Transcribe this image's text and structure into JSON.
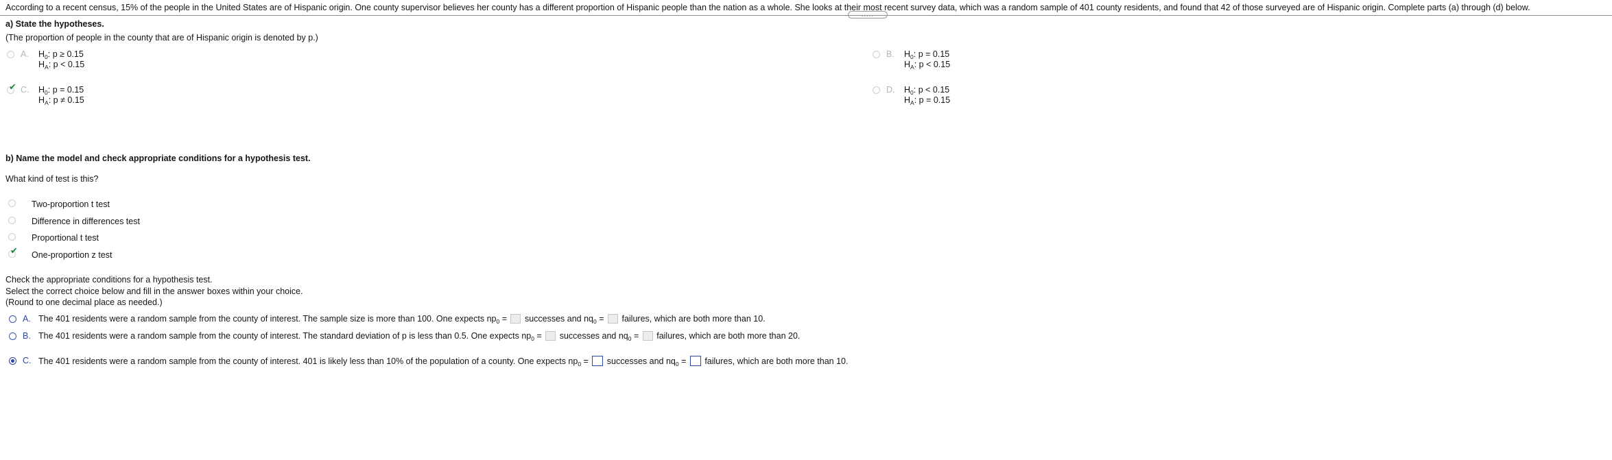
{
  "problem": {
    "statement": "According to a recent census, 15% of the people in the United States are of Hispanic origin. One county supervisor believes her county has a different proportion of Hispanic people than the nation as a whole. She looks at their most recent survey data, which was a random sample of 401 county residents, and found that 42 of those surveyed are of Hispanic origin. Complete parts (a) through (d) below.",
    "grabber_dots": "....."
  },
  "part_a": {
    "prompt": "a) State the hypotheses.",
    "note": "(The proportion of people in the county that are of Hispanic origin is denoted by p.)",
    "options": [
      {
        "letter": "A.",
        "h0_label": "H",
        "h0_sub": "0",
        "h0_rest": ": p ≥ 0.15",
        "ha_label": "H",
        "ha_sub": "A",
        "ha_rest": ": p < 0.15",
        "state": "unselected"
      },
      {
        "letter": "B.",
        "h0_label": "H",
        "h0_sub": "0",
        "h0_rest": ": p = 0.15",
        "ha_label": "H",
        "ha_sub": "A",
        "ha_rest": ": p < 0.15",
        "state": "unselected"
      },
      {
        "letter": "C.",
        "h0_label": "H",
        "h0_sub": "0",
        "h0_rest": ": p = 0.15",
        "ha_label": "H",
        "ha_sub": "A",
        "ha_rest": ": p ≠ 0.15",
        "state": "correct"
      },
      {
        "letter": "D.",
        "h0_label": "H",
        "h0_sub": "0",
        "h0_rest": ": p < 0.15",
        "ha_label": "H",
        "ha_sub": "A",
        "ha_rest": ": p = 0.15",
        "state": "unselected"
      }
    ],
    "checkmark_glyph": "✔"
  },
  "part_b": {
    "prompt": "b) Name the model and check appropriate conditions for a hypothesis test.",
    "question": "What kind of test is this?",
    "test_options": [
      {
        "label": "Two-proportion t test",
        "state": "unselected"
      },
      {
        "label": "Difference in differences test",
        "state": "unselected"
      },
      {
        "label": "Proportional t test",
        "state": "unselected"
      },
      {
        "label": "One-proportion z test",
        "state": "correct"
      }
    ]
  },
  "conditions": {
    "instruction_line_1": "Check the appropriate conditions for a hypothesis test.",
    "instruction_line_2": "Select the correct choice below and fill in the answer boxes within your choice.",
    "instruction_line_3": "(Round to one decimal place as needed.)",
    "options": [
      {
        "letter": "A.",
        "text_1": "The 401 residents were a random sample from the county of interest. The sample size is more than 100. One expects np",
        "sub_1": "0",
        "text_2": " = ",
        "text_3": " successes and nq",
        "sub_2": "0",
        "text_4": " = ",
        "text_5": " failures, which are both more than 10.",
        "state": "unselected"
      },
      {
        "letter": "B.",
        "text_1": "The 401 residents were a random sample from the county of interest. The standard deviation of p is less than 0.5. One expects np",
        "sub_1": "0",
        "text_2": " = ",
        "text_3": " successes and nq",
        "sub_2": "0",
        "text_4": " = ",
        "text_5": " failures, which are both more than 20.",
        "state": "unselected"
      },
      {
        "letter": "C.",
        "text_1": "The 401 residents were a random sample from the county of interest. 401 is likely less than 10% of the population of a county. One expects np",
        "sub_1": "0",
        "text_2": " = ",
        "text_3": " successes and nq",
        "sub_2": "0",
        "text_4": " = ",
        "text_5": " failures, which are both more than 10.",
        "state": "selected"
      }
    ]
  },
  "colors": {
    "accent_blue": "#2c45a8",
    "check_green": "#1a8a3c",
    "faded_grey": "#b4b4b4",
    "box_grey": "#ececec"
  }
}
